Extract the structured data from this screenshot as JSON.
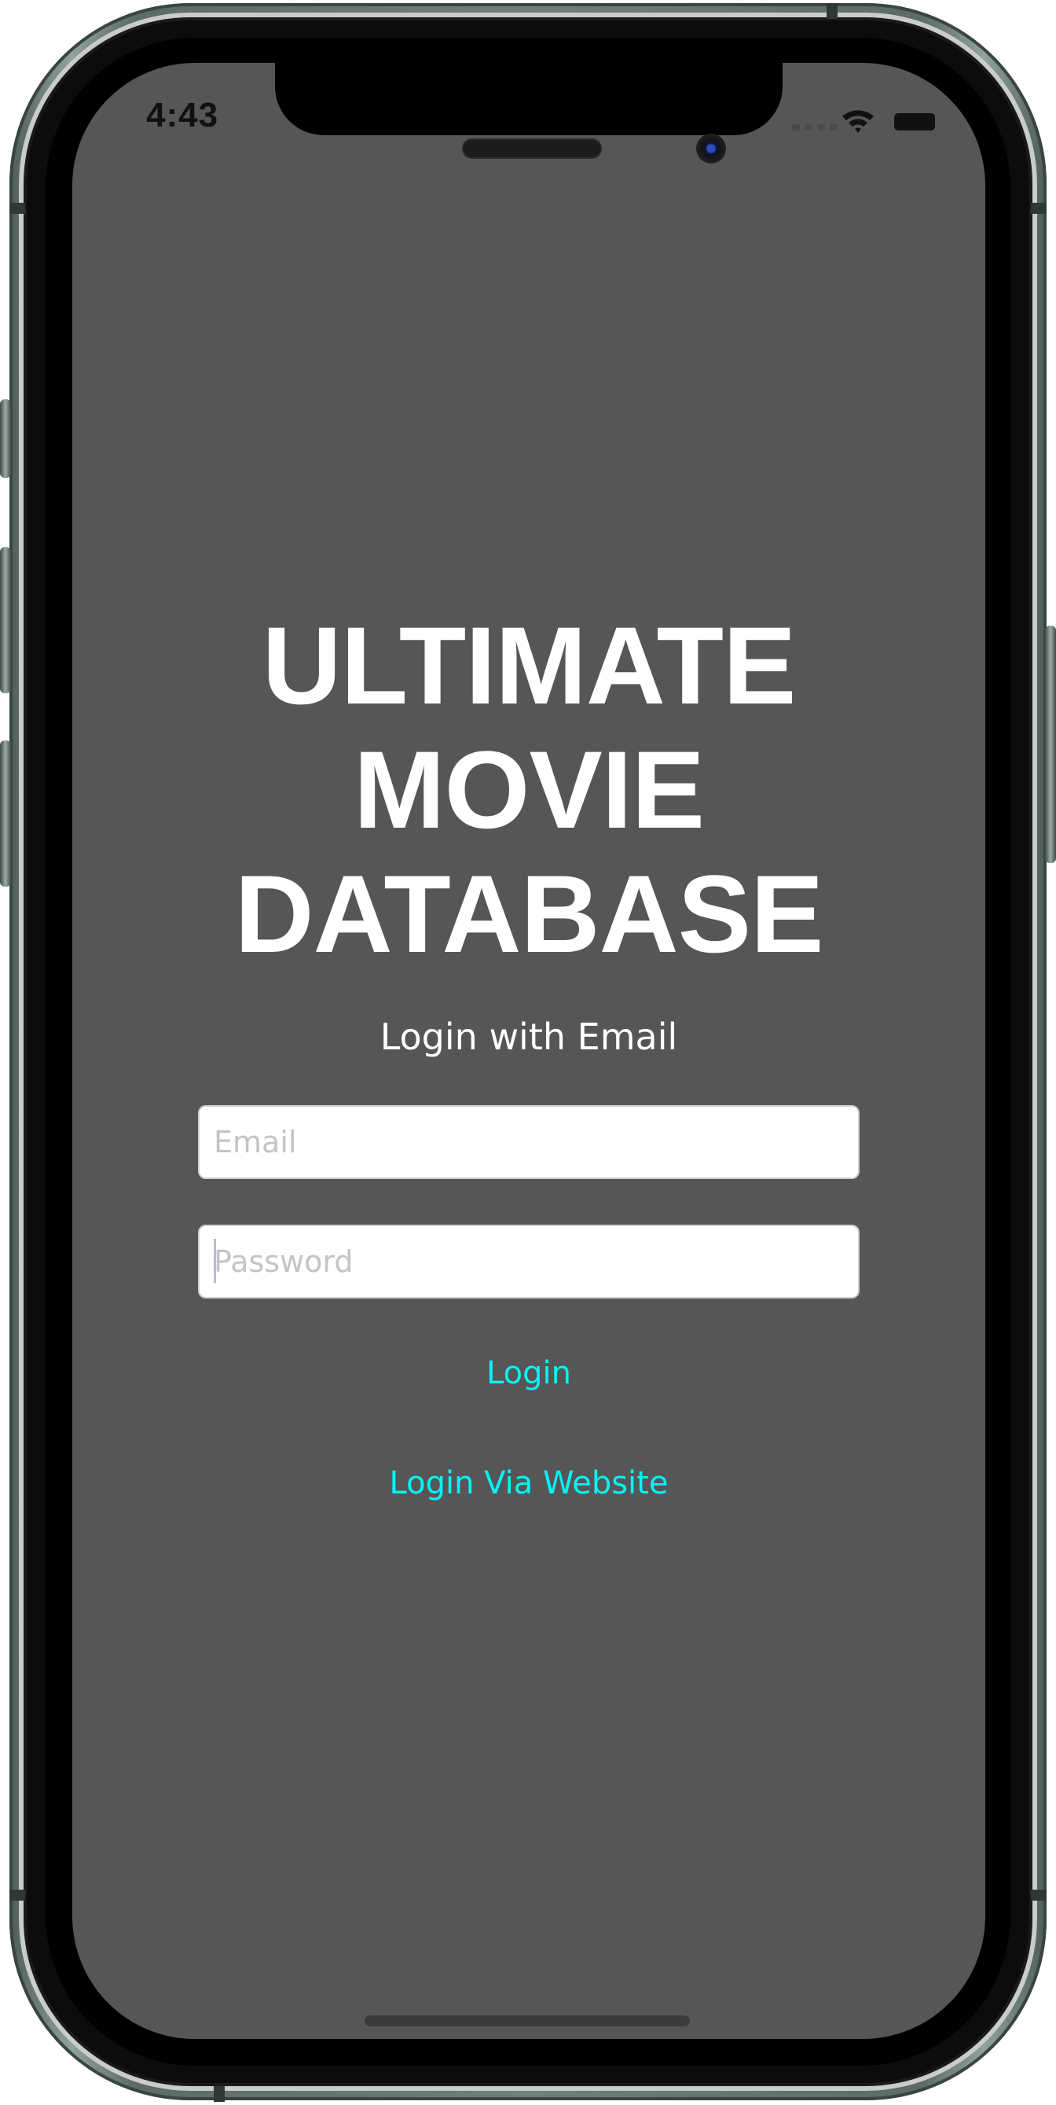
{
  "status_bar": {
    "time": "4:43",
    "icons": [
      "signal-dots-icon",
      "wifi-icon",
      "battery-icon"
    ]
  },
  "app": {
    "title_lines": [
      "ULTIMATE",
      "MOVIE",
      "DATABASE"
    ],
    "subtitle": "Login with Email"
  },
  "form": {
    "email": {
      "placeholder": "Email",
      "value": ""
    },
    "password": {
      "placeholder": "Password",
      "value": ""
    },
    "login_label": "Login",
    "login_website_label": "Login Via Website"
  },
  "colors": {
    "screen_background": "#565656",
    "link": "#00f6f6",
    "title_text": "#ffffff",
    "frame": "#6f807a"
  }
}
